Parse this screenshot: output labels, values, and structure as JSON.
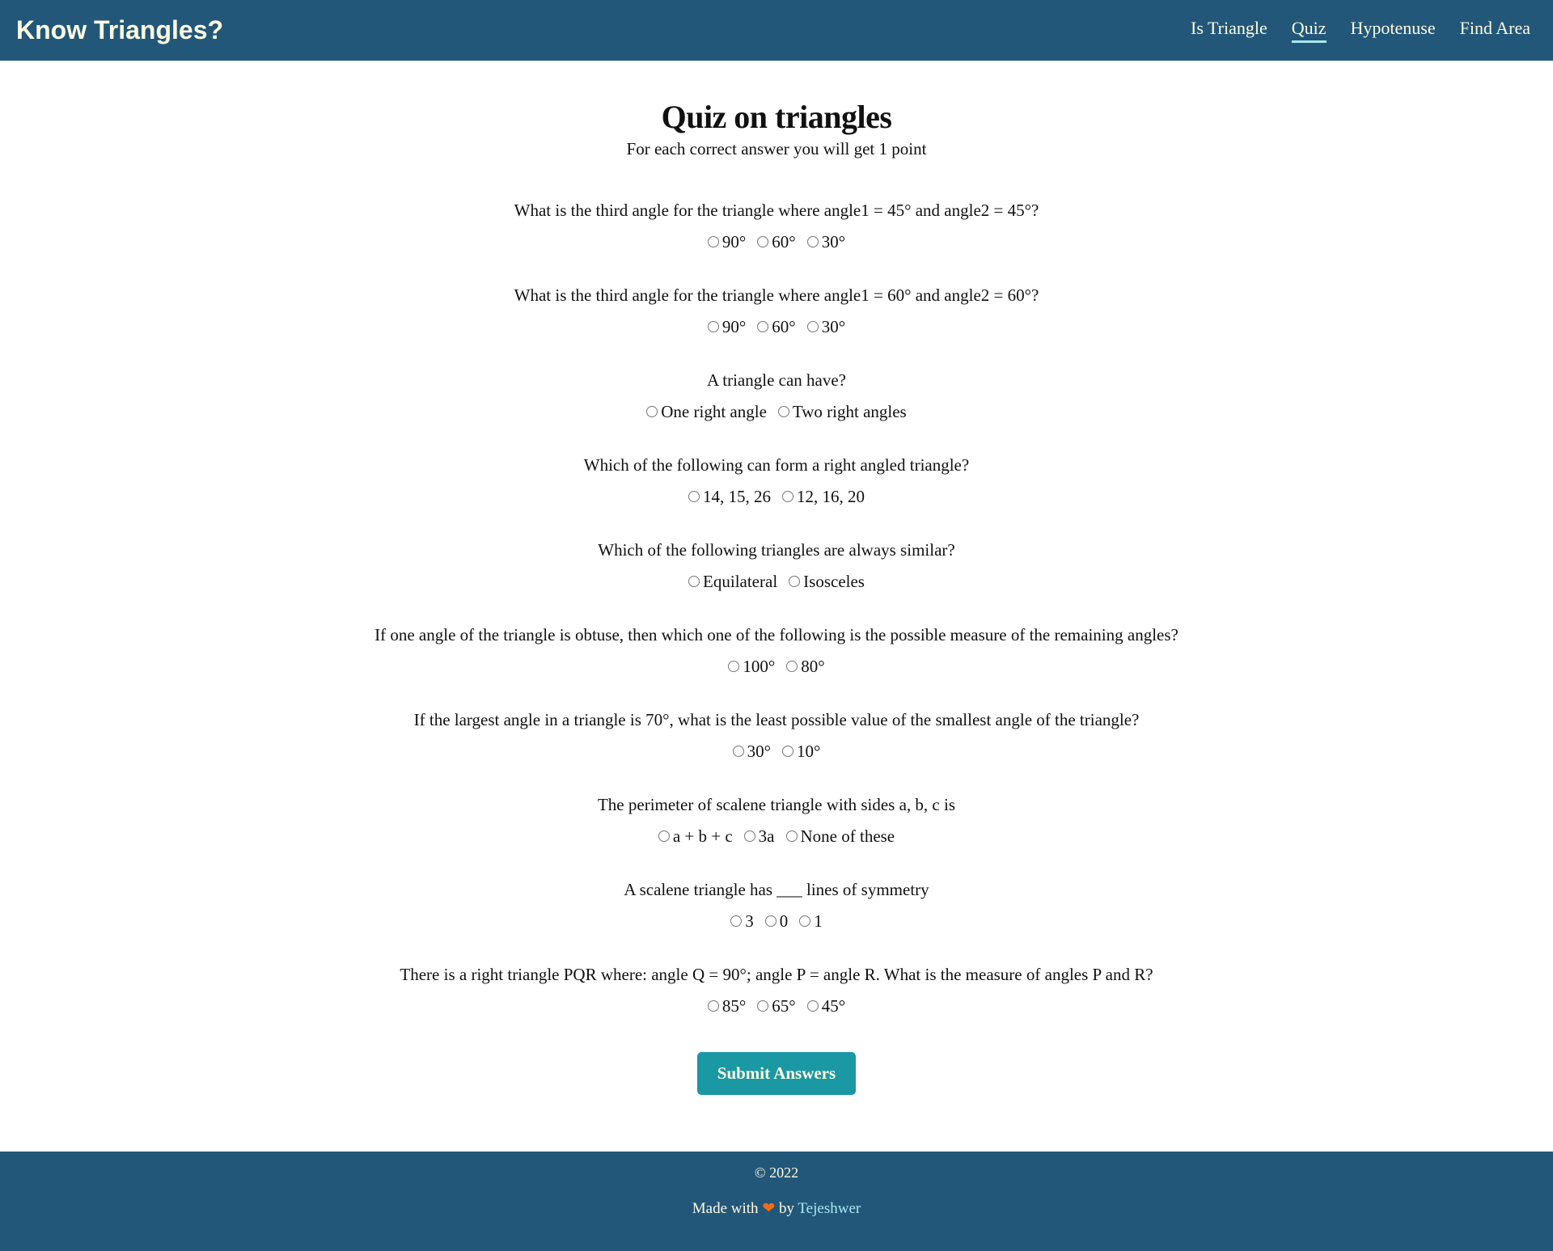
{
  "nav": {
    "brand": "Know Triangles?",
    "links": [
      "Is Triangle",
      "Quiz",
      "Hypotenuse",
      "Find Area"
    ],
    "active": "Quiz"
  },
  "main": {
    "title": "Quiz on triangles",
    "subtitle": "For each correct answer you will get 1 point",
    "questions": [
      {
        "q": "What is the third angle for the triangle where angle1 = 45° and angle2 = 45°?",
        "options": [
          "90°",
          "60°",
          "30°"
        ]
      },
      {
        "q": "What is the third angle for the triangle where angle1 = 60° and angle2 = 60°?",
        "options": [
          "90°",
          "60°",
          "30°"
        ]
      },
      {
        "q": "A triangle can have?",
        "options": [
          "One right angle",
          "Two right angles"
        ]
      },
      {
        "q": "Which of the following can form a right angled triangle?",
        "options": [
          "14, 15, 26",
          "12, 16, 20"
        ]
      },
      {
        "q": "Which of the following triangles are always similar?",
        "options": [
          "Equilateral",
          "Isosceles"
        ]
      },
      {
        "q": "If one angle of the triangle is obtuse, then which one of the following is the possible measure of the remaining angles?",
        "options": [
          "100°",
          "80°"
        ]
      },
      {
        "q": "If the largest angle in a triangle is 70°, what is the least possible value of the smallest angle of the triangle?",
        "options": [
          "30°",
          "10°"
        ]
      },
      {
        "q": "The perimeter of scalene triangle with sides a, b, c is",
        "options": [
          "a + b + c",
          "3a",
          "None of these"
        ]
      },
      {
        "q": "A scalene triangle has ___ lines of symmetry",
        "options": [
          "3",
          "0",
          "1"
        ]
      },
      {
        "q": "There is a right triangle PQR where: angle Q = 90°; angle P = angle R. What is the measure of angles P and R?",
        "options": [
          "85°",
          "65°",
          "45°"
        ]
      }
    ],
    "submit": "Submit Answers"
  },
  "footer": {
    "copyright": "© 2022",
    "made_with": "Made with",
    "heart": "❤",
    "by": "by",
    "author": "Tejeshwer"
  }
}
